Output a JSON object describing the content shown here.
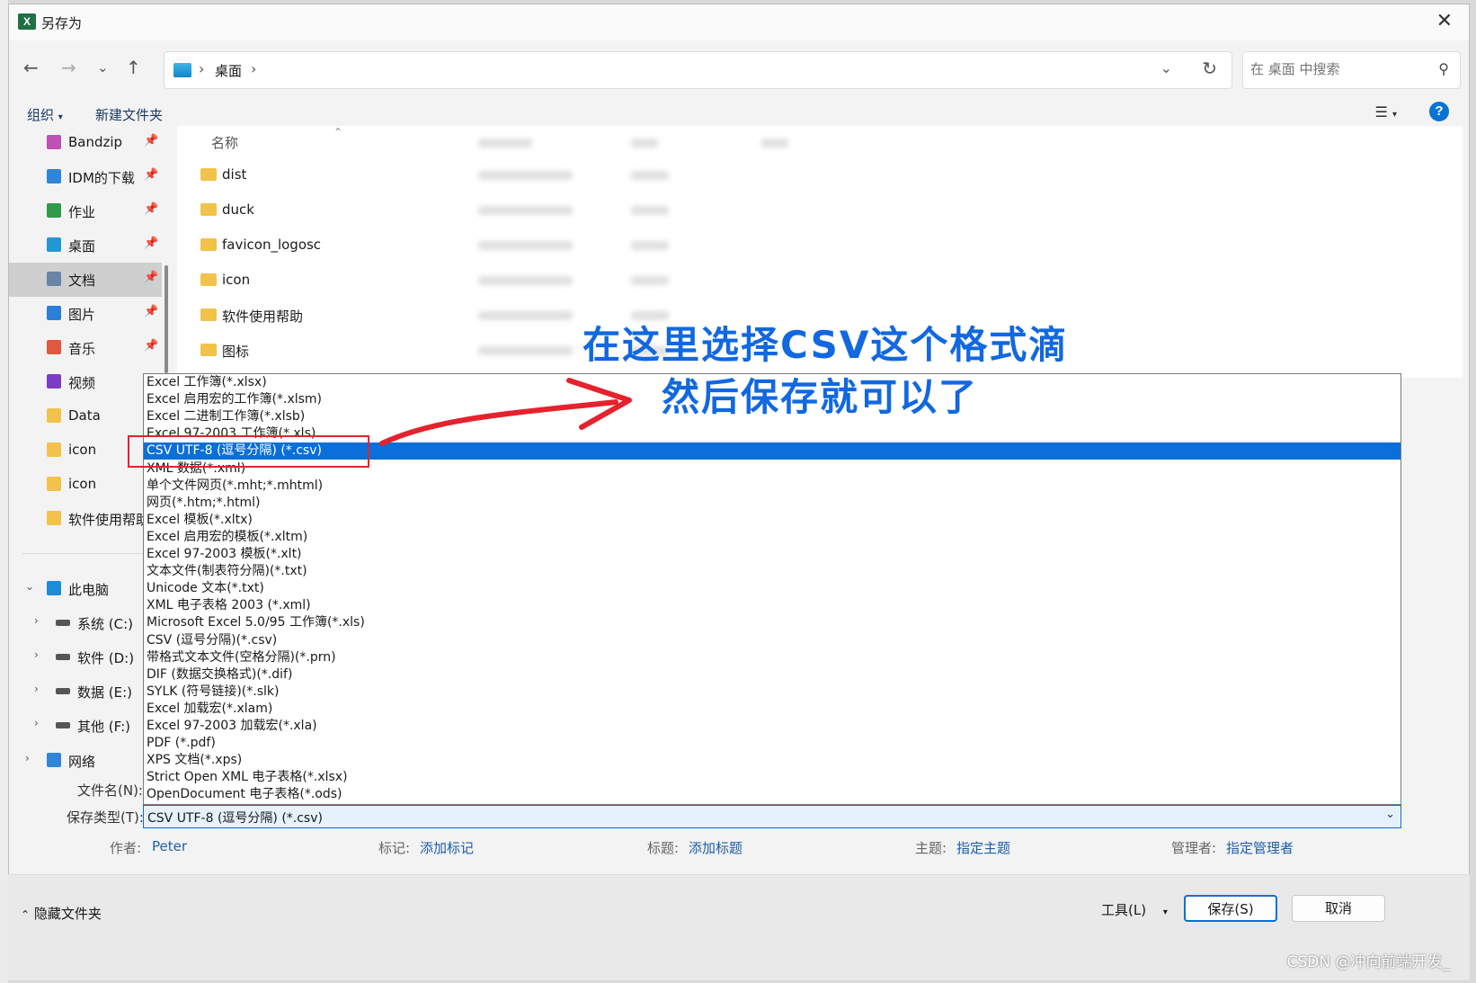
{
  "window": {
    "title": "另存为",
    "app_icon": "X"
  },
  "nav": {
    "breadcrumb": "桌面",
    "search_placeholder": "在 桌面 中搜索"
  },
  "toolbar": {
    "organize": "组织",
    "new_folder": "新建文件夹"
  },
  "sidebar": {
    "quick": [
      {
        "label": "Bandzip",
        "icon": "bandzip-icon",
        "color": "#c04fb6"
      },
      {
        "label": "IDM的下载",
        "icon": "download-icon",
        "color": "#2f86d8"
      },
      {
        "label": "作业",
        "icon": "book-icon",
        "color": "#2e9b4a"
      },
      {
        "label": "桌面",
        "icon": "desktop-icon",
        "color": "#2496d6"
      },
      {
        "label": "文档",
        "icon": "document-icon",
        "color": "#6a84a6"
      },
      {
        "label": "图片",
        "icon": "picture-icon",
        "color": "#2c7fd8"
      },
      {
        "label": "音乐",
        "icon": "music-icon",
        "color": "#e2583e"
      },
      {
        "label": "视频",
        "icon": "video-icon",
        "color": "#7c3cc8"
      },
      {
        "label": "Data",
        "icon": "folder-icon",
        "color": "#f2c24b"
      },
      {
        "label": "icon",
        "icon": "folder-icon",
        "color": "#f2c24b"
      },
      {
        "label": "icon",
        "icon": "folder-icon",
        "color": "#f2c24b"
      },
      {
        "label": "软件使用帮助",
        "icon": "folder-icon",
        "color": "#f2c24b"
      }
    ],
    "this_pc": "此电脑",
    "drives": [
      "系统 (C:)",
      "软件 (D:)",
      "数据 (E:)",
      "其他 (F:)"
    ],
    "network": "网络"
  },
  "files": {
    "column_name": "名称",
    "items": [
      "dist",
      "duck",
      "favicon_logosc",
      "icon",
      "软件使用帮助",
      "图标"
    ]
  },
  "file_types": [
    "Excel 工作簿(*.xlsx)",
    "Excel 启用宏的工作簿(*.xlsm)",
    "Excel 二进制工作簿(*.xlsb)",
    "Excel 97-2003 工作簿(*.xls)",
    "CSV UTF-8 (逗号分隔) (*.csv)",
    "XML 数据(*.xml)",
    "单个文件网页(*.mht;*.mhtml)",
    "网页(*.htm;*.html)",
    "Excel 模板(*.xltx)",
    "Excel 启用宏的模板(*.xltm)",
    "Excel 97-2003 模板(*.xlt)",
    "文本文件(制表符分隔)(*.txt)",
    "Unicode 文本(*.txt)",
    "XML 电子表格 2003 (*.xml)",
    "Microsoft Excel 5.0/95 工作簿(*.xls)",
    "CSV (逗号分隔)(*.csv)",
    "带格式文本文件(空格分隔)(*.prn)",
    "DIF (数据交换格式)(*.dif)",
    "SYLK (符号链接)(*.slk)",
    "Excel 加载宏(*.xlam)",
    "Excel 97-2003 加载宏(*.xla)",
    "PDF (*.pdf)",
    "XPS 文档(*.xps)",
    "Strict Open XML 电子表格(*.xlsx)",
    "OpenDocument 电子表格(*.ods)"
  ],
  "selected_type_index": 4,
  "form": {
    "filename_label": "文件名(N):",
    "savetype_label": "保存类型(T):",
    "savetype_value": "CSV UTF-8 (逗号分隔) (*.csv)"
  },
  "meta": {
    "author_k": "作者:",
    "author_v": "Peter",
    "tags_k": "标记:",
    "tags_v": "添加标记",
    "title_k": "标题:",
    "title_v": "添加标题",
    "subject_k": "主题:",
    "subject_v": "指定主题",
    "manager_k": "管理者:",
    "manager_v": "指定管理者"
  },
  "footer": {
    "hide_folders": "隐藏文件夹",
    "tools": "工具(L)",
    "save": "保存(S)",
    "cancel": "取消",
    "watermark": "CSDN @冲向前端开发_"
  },
  "annotation": {
    "line1": "在这里选择CSV这个格式滴",
    "line2": "然后保存就可以了",
    "color": "#1168e0",
    "arrow_color": "#e5222d"
  },
  "colors": {
    "accent": "#0a6fd8",
    "highlight_box": "#e5222d"
  }
}
